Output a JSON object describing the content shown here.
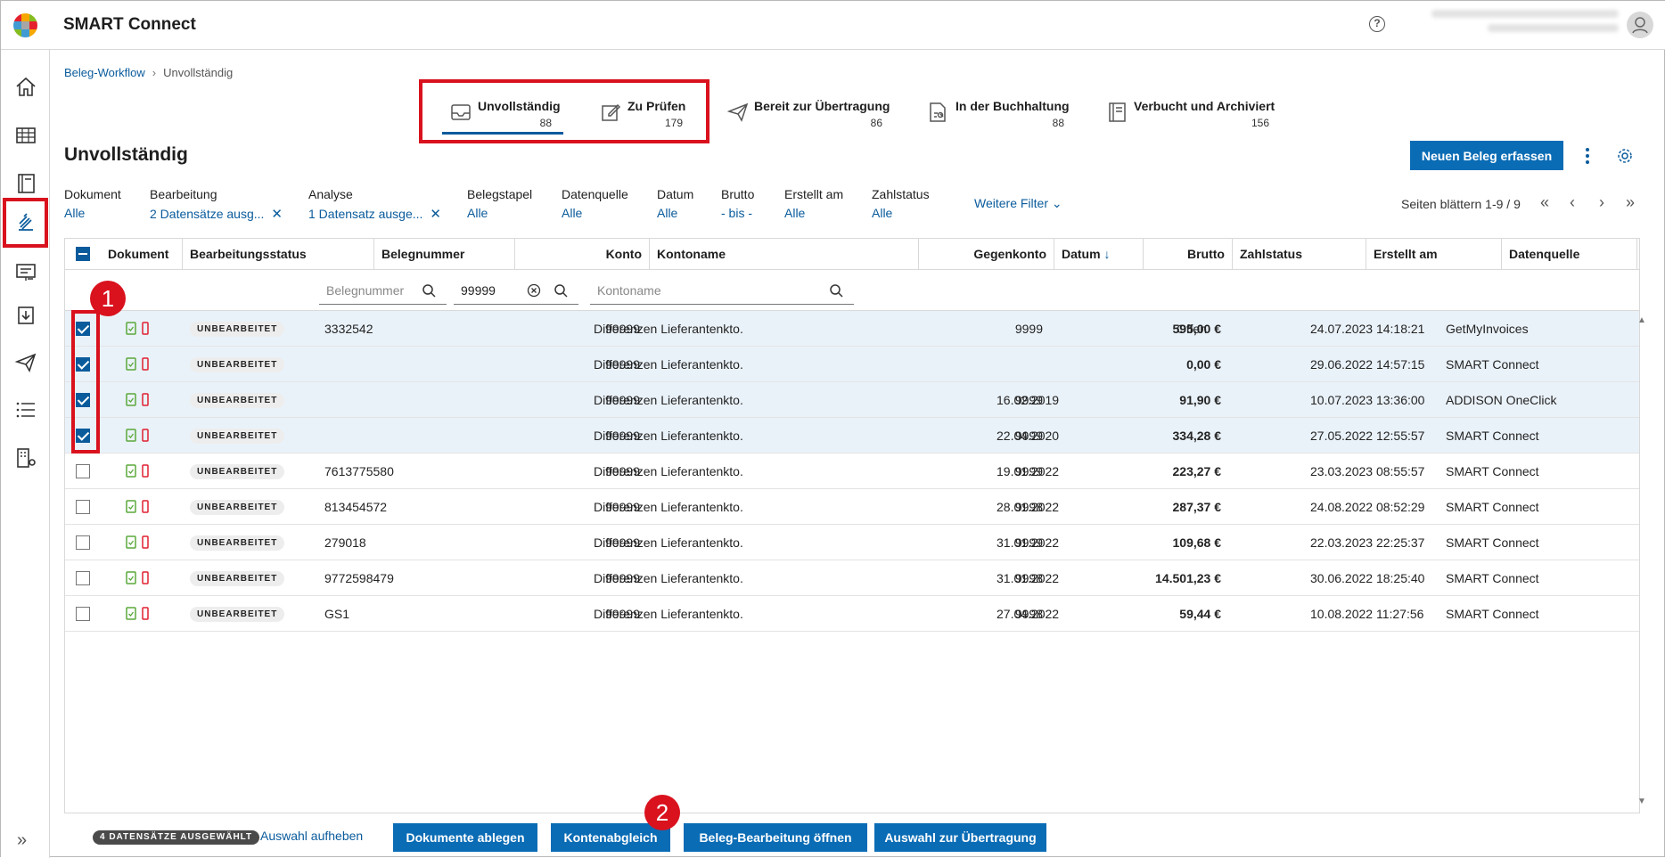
{
  "app": {
    "title": "SMART Connect"
  },
  "breadcrumb": {
    "root": "Beleg-Workflow",
    "current": "Unvollständig"
  },
  "workflow_tabs": [
    {
      "label": "Unvollständig",
      "count": "88",
      "active": true
    },
    {
      "label": "Zu Prüfen",
      "count": "179"
    },
    {
      "label": "Bereit zur Übertragung",
      "count": "86"
    },
    {
      "label": "In der Buchhaltung",
      "count": "88"
    },
    {
      "label": "Verbucht und Archiviert",
      "count": "156"
    }
  ],
  "page": {
    "title": "Unvollständig",
    "new_button": "Neuen Beleg erfassen"
  },
  "filters": [
    {
      "label": "Dokument",
      "value": "Alle"
    },
    {
      "label": "Bearbeitung",
      "value": "2 Datensätze ausg..."
    },
    {
      "label": "Analyse",
      "value": "1 Datensatz ausge..."
    },
    {
      "label": "Belegstapel",
      "value": "Alle"
    },
    {
      "label": "Datenquelle",
      "value": "Alle"
    },
    {
      "label": "Datum",
      "value": "Alle"
    },
    {
      "label": "Brutto",
      "value": "- bis -"
    },
    {
      "label": "Erstellt am",
      "value": "Alle"
    },
    {
      "label": "Zahlstatus",
      "value": "Alle"
    }
  ],
  "more_filters": "Weitere Filter",
  "paging": "Seiten blättern 1-9 / 9",
  "table": {
    "columns": [
      "Dokument",
      "Bearbeitungsstatus",
      "Belegnummer",
      "Konto",
      "Kontoname",
      "Gegenkonto",
      "Datum",
      "Brutto",
      "Zahlstatus",
      "Erstellt am",
      "Datenquelle"
    ],
    "search": {
      "belegnummer_placeholder": "Belegnummer",
      "konto_value": "99999",
      "kontoname_placeholder": "Kontoname"
    },
    "rows": [
      {
        "selected": true,
        "status": "UNBEARBEITET",
        "belegnummer": "3332542",
        "konto": "99999",
        "kontoname": "Differenzen Lieferantenkto.",
        "gegenkonto": "9999",
        "datum": "",
        "brutto": "595,00 €",
        "zahlstatus": "Offen",
        "erstellt": "24.07.2023 14:18:21",
        "quelle": "GetMyInvoices"
      },
      {
        "selected": true,
        "status": "UNBEARBEITET",
        "belegnummer": "",
        "konto": "99999",
        "kontoname": "Differenzen Lieferantenkto.",
        "gegenkonto": "",
        "datum": "",
        "brutto": "0,00 €",
        "zahlstatus": "",
        "erstellt": "29.06.2022 14:57:15",
        "quelle": "SMART Connect"
      },
      {
        "selected": true,
        "status": "UNBEARBEITET",
        "belegnummer": "",
        "konto": "99999",
        "kontoname": "Differenzen Lieferantenkto.",
        "gegenkonto": "9999",
        "datum": "16.02.2019",
        "brutto": "91,90 €",
        "zahlstatus": "",
        "erstellt": "10.07.2023 13:36:00",
        "quelle": "ADDISON OneClick"
      },
      {
        "selected": true,
        "status": "UNBEARBEITET",
        "belegnummer": "",
        "konto": "99999",
        "kontoname": "Differenzen Lieferantenkto.",
        "gegenkonto": "9999",
        "datum": "22.04.2020",
        "brutto": "334,28 €",
        "zahlstatus": "",
        "erstellt": "27.05.2022 12:55:57",
        "quelle": "SMART Connect"
      },
      {
        "selected": false,
        "status": "UNBEARBEITET",
        "belegnummer": "7613775580",
        "konto": "99999",
        "kontoname": "Differenzen Lieferantenkto.",
        "gegenkonto": "9999",
        "datum": "19.01.2022",
        "brutto": "223,27 €",
        "zahlstatus": "",
        "erstellt": "23.03.2023 08:55:57",
        "quelle": "SMART Connect"
      },
      {
        "selected": false,
        "status": "UNBEARBEITET",
        "belegnummer": "813454572",
        "konto": "99999",
        "kontoname": "Differenzen Lieferantenkto.",
        "gegenkonto": "9998",
        "datum": "28.01.2022",
        "brutto": "287,37 €",
        "zahlstatus": "",
        "erstellt": "24.08.2022 08:52:29",
        "quelle": "SMART Connect"
      },
      {
        "selected": false,
        "status": "UNBEARBEITET",
        "belegnummer": "279018",
        "konto": "99999",
        "kontoname": "Differenzen Lieferantenkto.",
        "gegenkonto": "9999",
        "datum": "31.01.2022",
        "brutto": "109,68 €",
        "zahlstatus": "",
        "erstellt": "22.03.2023 22:25:37",
        "quelle": "SMART Connect"
      },
      {
        "selected": false,
        "status": "UNBEARBEITET",
        "belegnummer": "9772598479",
        "konto": "99999",
        "kontoname": "Differenzen Lieferantenkto.",
        "gegenkonto": "9998",
        "datum": "31.01.2022",
        "brutto": "14.501,23 €",
        "zahlstatus": "",
        "erstellt": "30.06.2022 18:25:40",
        "quelle": "SMART Connect"
      },
      {
        "selected": false,
        "status": "UNBEARBEITET",
        "belegnummer": "GS1",
        "konto": "99999",
        "kontoname": "Differenzen Lieferantenkto.",
        "gegenkonto": "9998",
        "datum": "27.04.2022",
        "brutto": "59,44 €",
        "zahlstatus": "",
        "erstellt": "10.08.2022 11:27:56",
        "quelle": "SMART Connect"
      }
    ]
  },
  "footer": {
    "selected_badge": "4 DATENSÄTZE AUSGEWÄHLT",
    "clear_selection": "Auswahl aufheben",
    "buttons": [
      "Dokumente ablegen",
      "Kontenabgleich",
      "Beleg-Bearbeitung öffnen",
      "Auswahl zur Übertragung"
    ]
  },
  "markers": [
    "1",
    "2"
  ],
  "colors": {
    "accent": "#0a5b9c",
    "button": "#0a6cb5",
    "highlight": "#d9121e",
    "selected_row": "#eaf2f9"
  }
}
